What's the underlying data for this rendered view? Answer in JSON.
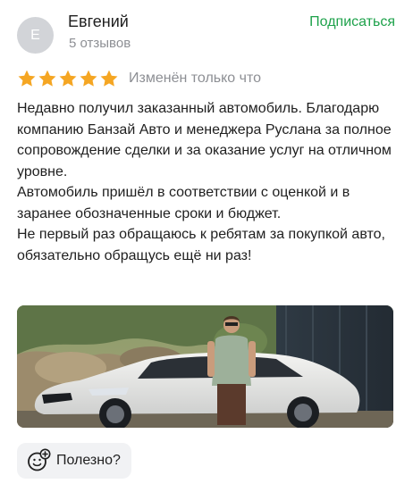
{
  "author": {
    "initial": "Е",
    "name": "Евгений",
    "reviews_count": "5 отзывов"
  },
  "subscribe_label": "Подписаться",
  "rating": {
    "stars": 5,
    "max": 5,
    "color": "#f5a623",
    "edited_label": "Изменён только что"
  },
  "review": {
    "paragraphs": [
      "Недавно получил заказанный автомобиль. Благодарю компанию Банзай Авто и менеджера Руслана за полное сопровождение сделки и за оказание услуг на отличном уровне.",
      "Автомобиль пришёл в соответствии с оценкой и в заранее обозначенные сроки и бюджет.",
      "Не первый раз обращаюсь к ребятам за покупкой авто, обязательно обращусь ещё ни раз!"
    ]
  },
  "photo": {
    "subject": "white BMW station wagon with man standing in front"
  },
  "helpful": {
    "label": "Полезно?",
    "icon": "add-reaction-icon"
  },
  "colors": {
    "accent": "#1ea24b",
    "muted": "#8d8f94",
    "chip_bg": "#f1f2f4"
  }
}
